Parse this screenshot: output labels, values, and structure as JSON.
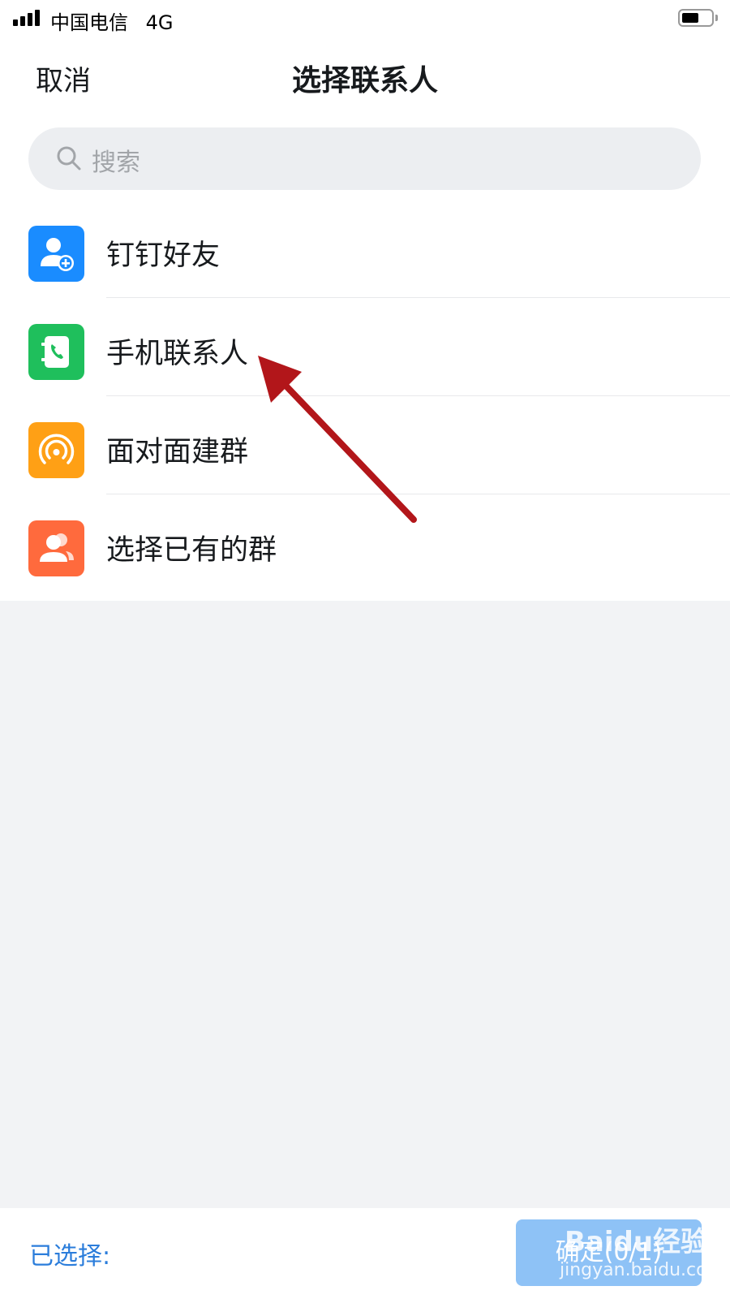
{
  "status_bar": {
    "carrier": "中国电信",
    "network": "4G",
    "battery_level": 0.55
  },
  "nav": {
    "cancel_label": "取消",
    "title": "选择联系人"
  },
  "search": {
    "placeholder": "搜索"
  },
  "options": [
    {
      "label": "钉钉好友",
      "icon": "add-friend-icon",
      "color": "#1a8cff"
    },
    {
      "label": "手机联系人",
      "icon": "phone-contact-icon",
      "color": "#1fbf5c"
    },
    {
      "label": "面对面建群",
      "icon": "face-to-face-signal-icon",
      "color": "#ffa015"
    },
    {
      "label": "选择已有的群",
      "icon": "group-icon",
      "color": "#ff6a3d"
    }
  ],
  "bottom_bar": {
    "selected_label": "已选择:",
    "confirm_label": "确定(0/1)"
  },
  "watermark": {
    "brand": "Baidu经验",
    "url": "jingyan.baidu.com"
  },
  "annotation": {
    "arrow_color": "#b2161a"
  }
}
